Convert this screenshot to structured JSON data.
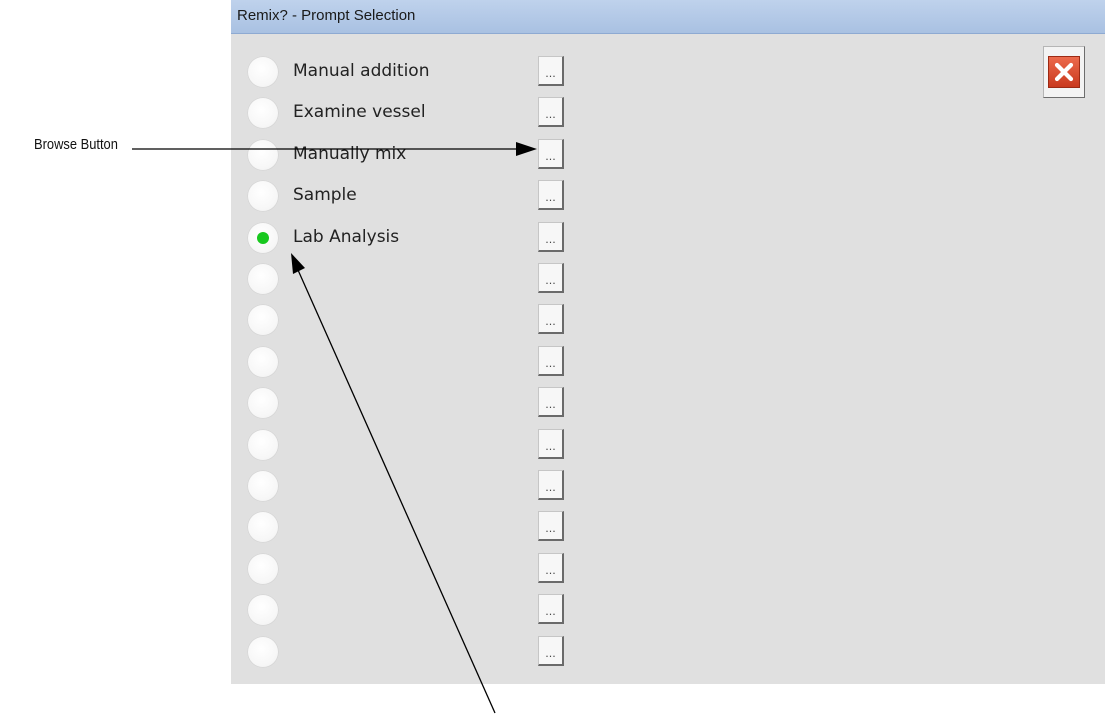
{
  "window": {
    "title": "Remix? - Prompt Selection",
    "close_icon": "close-icon"
  },
  "callout": {
    "browse_label": "Browse Button"
  },
  "rows": [
    {
      "label": "Manual addition",
      "selected": false,
      "browse_label": "..."
    },
    {
      "label": "Examine vessel",
      "selected": false,
      "browse_label": "..."
    },
    {
      "label": "Manually mix",
      "selected": false,
      "browse_label": "..."
    },
    {
      "label": "Sample",
      "selected": false,
      "browse_label": "..."
    },
    {
      "label": "Lab Analysis",
      "selected": true,
      "browse_label": "..."
    },
    {
      "label": "",
      "selected": false,
      "browse_label": "..."
    },
    {
      "label": "",
      "selected": false,
      "browse_label": "..."
    },
    {
      "label": "",
      "selected": false,
      "browse_label": "..."
    },
    {
      "label": "",
      "selected": false,
      "browse_label": "..."
    },
    {
      "label": "",
      "selected": false,
      "browse_label": "..."
    },
    {
      "label": "",
      "selected": false,
      "browse_label": "..."
    },
    {
      "label": "",
      "selected": false,
      "browse_label": "..."
    },
    {
      "label": "",
      "selected": false,
      "browse_label": "..."
    },
    {
      "label": "",
      "selected": false,
      "browse_label": "..."
    },
    {
      "label": "",
      "selected": false,
      "browse_label": "..."
    }
  ],
  "colors": {
    "selected_dot": "#18c81e",
    "dialog_background": "#e0e0e0",
    "titlebar": "#b3c9e8",
    "close_button": "#d94a2c"
  }
}
